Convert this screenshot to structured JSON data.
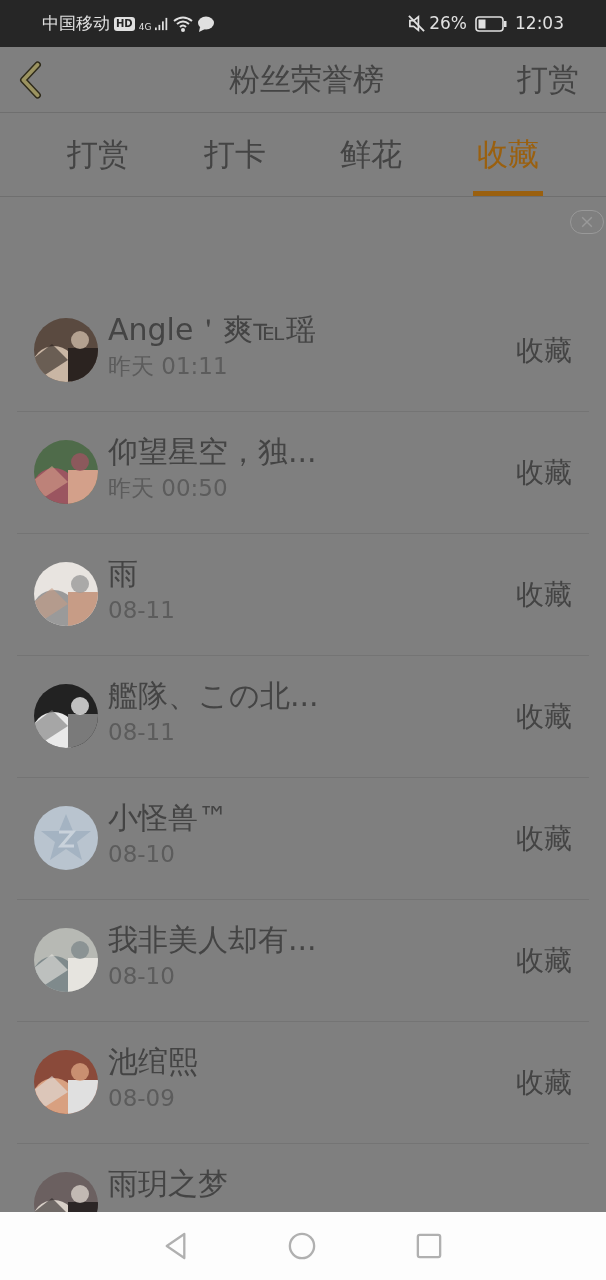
{
  "status_bar": {
    "carrier": "中国移动",
    "hd": "HD",
    "network": "4G",
    "battery": "26%",
    "time": "12:03"
  },
  "header": {
    "title": "粉丝荣誉榜",
    "action": "打赏"
  },
  "tabs": [
    {
      "label": "打赏",
      "selected": false
    },
    {
      "label": "打卡",
      "selected": false
    },
    {
      "label": "鲜花",
      "selected": false
    },
    {
      "label": "收藏",
      "selected": true
    }
  ],
  "fans": [
    {
      "name": "Angle＇爽℡瑶",
      "time": "昨天 01:11",
      "action": "收藏"
    },
    {
      "name": "仰望星空，独...",
      "time": "昨天 00:50",
      "action": "收藏"
    },
    {
      "name": "雨",
      "time": "08-11",
      "action": "收藏"
    },
    {
      "name": "艦隊、この北...",
      "time": "08-11",
      "action": "收藏"
    },
    {
      "name": "小怪兽™",
      "time": "08-10",
      "action": "收藏",
      "avatar": {
        "kind": "default"
      }
    },
    {
      "name": "我非美人却有...",
      "time": "08-10",
      "action": "收藏"
    },
    {
      "name": "池绾熙",
      "time": "08-09",
      "action": "收藏"
    },
    {
      "name": "雨玥之梦"
    }
  ]
}
